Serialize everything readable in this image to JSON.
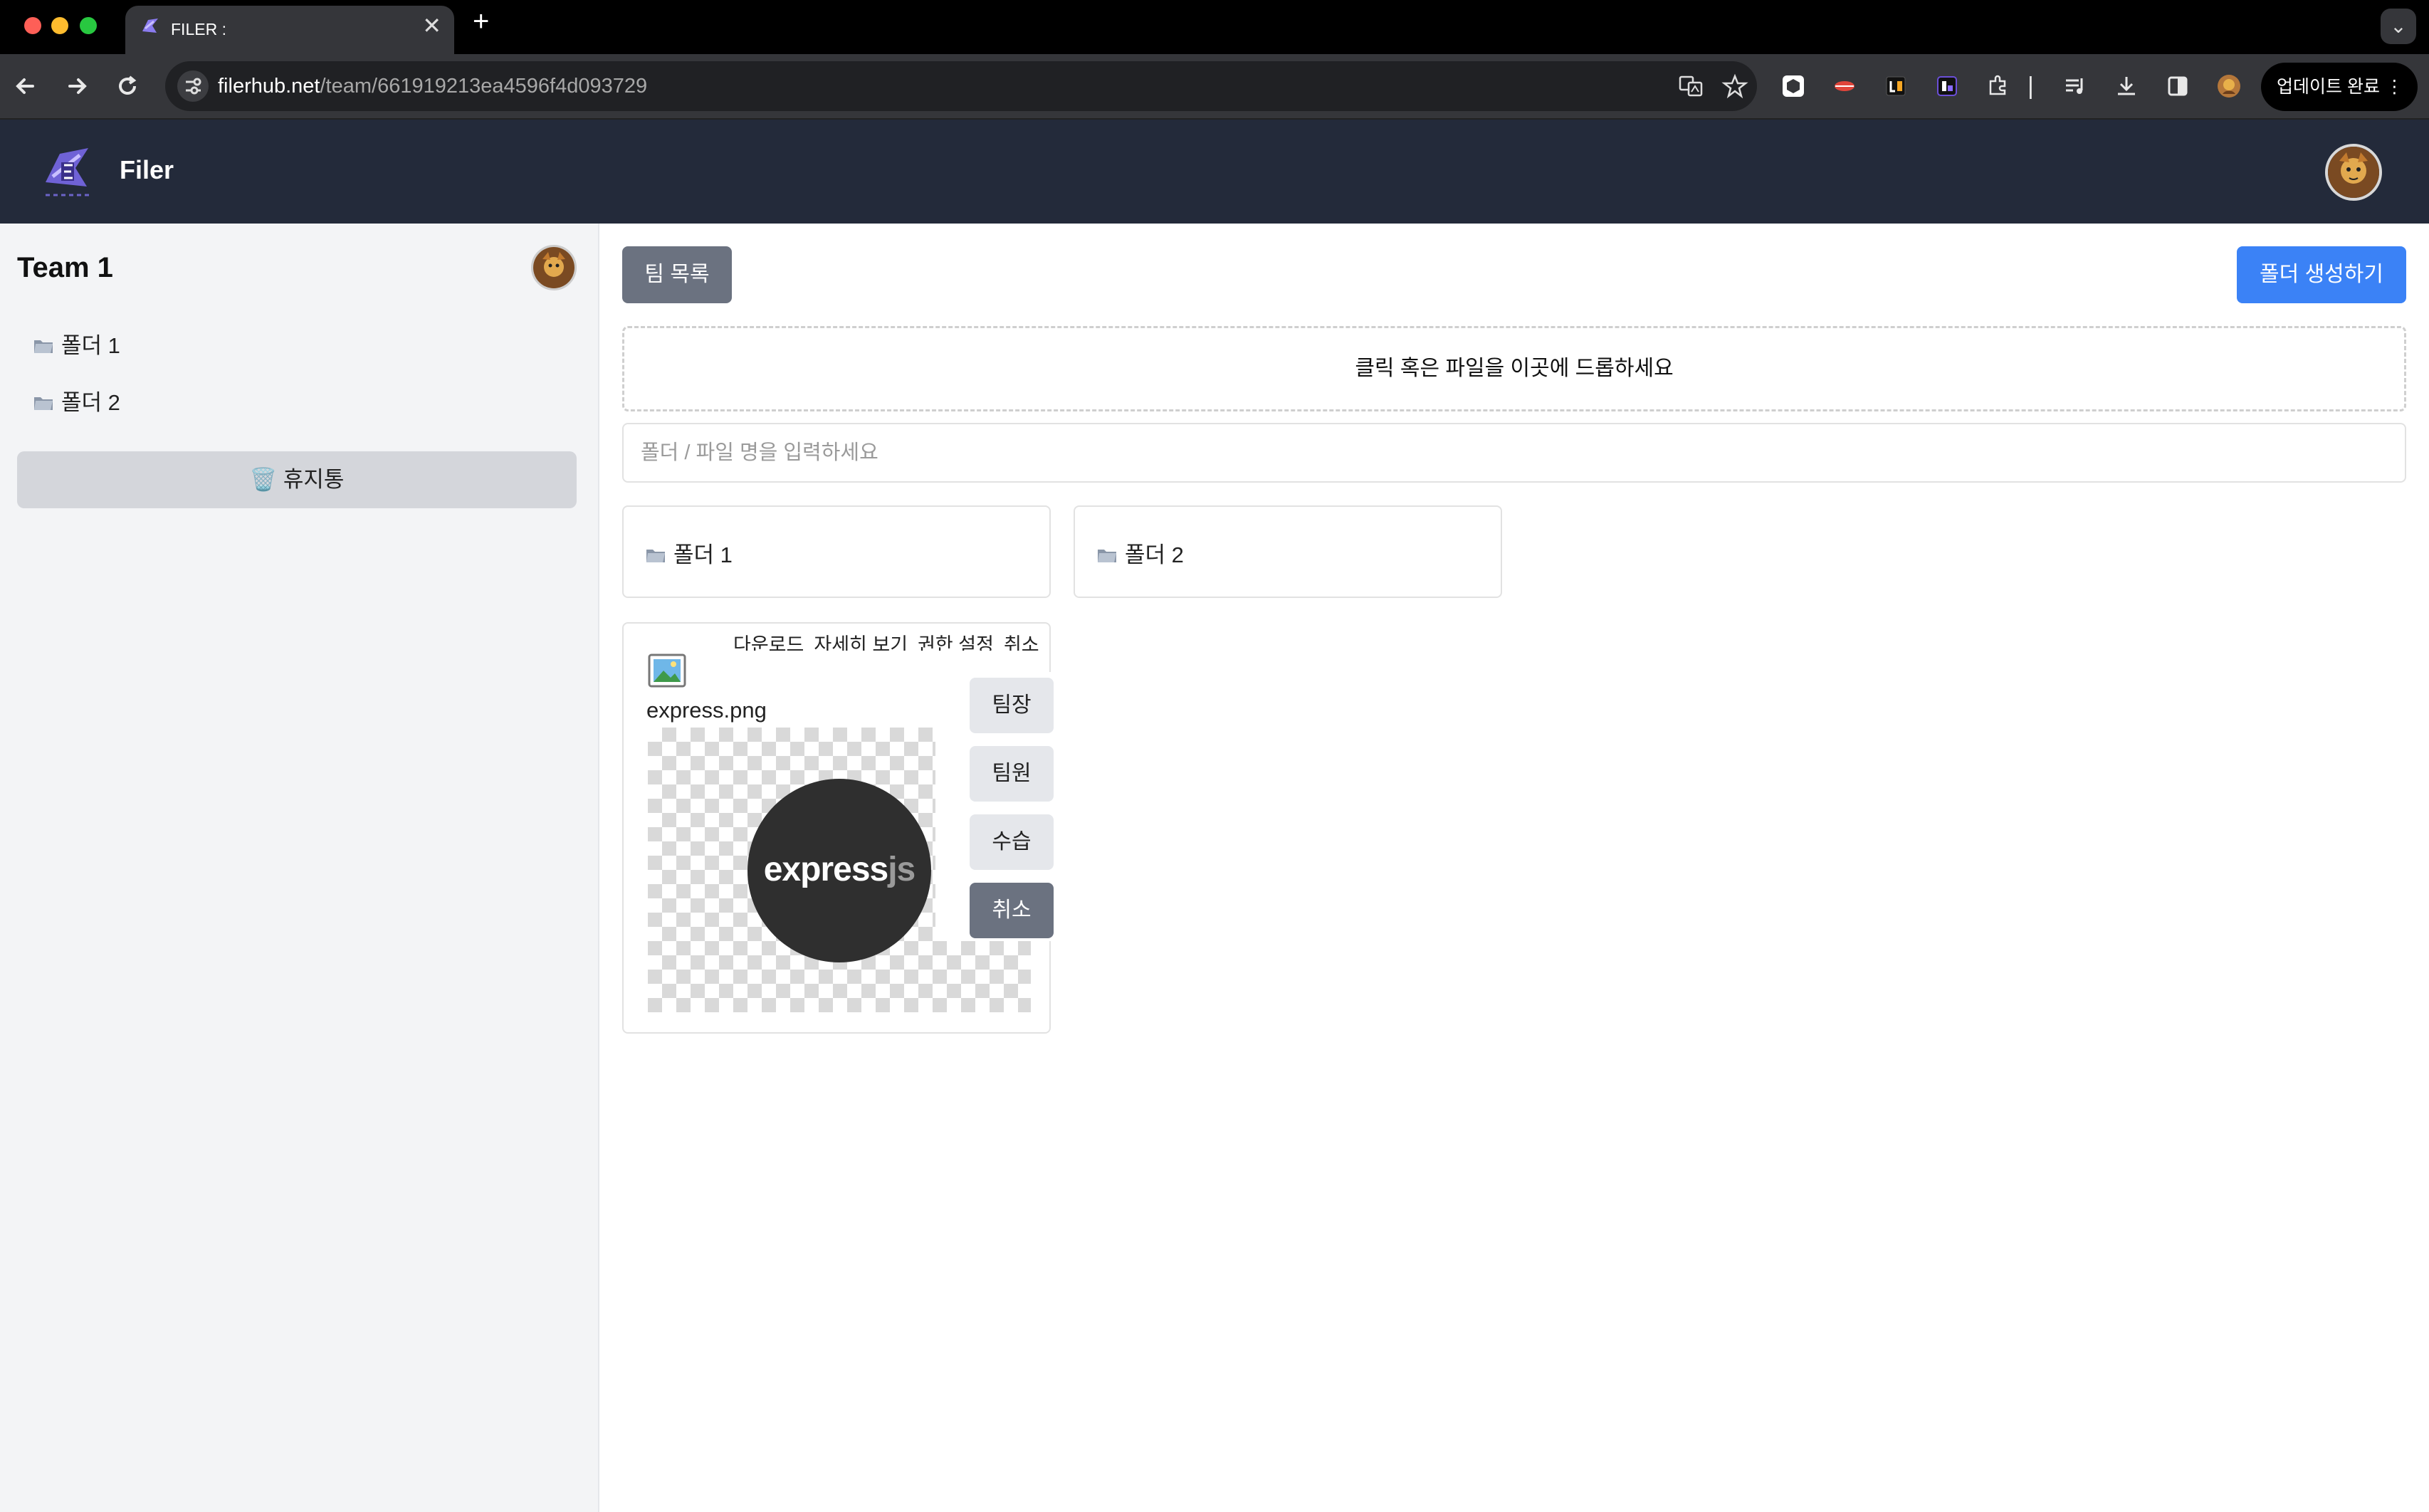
{
  "browser": {
    "tab_title": "FILER :",
    "tab_close": "✕",
    "new_tab": "+",
    "tab_menu": "⌄",
    "url_host": "filerhub.net",
    "url_path": "/team/661919213ea4596f4d093729",
    "update_label": "업데이트 완료",
    "update_menu": "⋮"
  },
  "app": {
    "name": "Filer"
  },
  "sidebar": {
    "team_name": "Team 1",
    "folders": [
      {
        "label": "폴더 1"
      },
      {
        "label": "폴더 2"
      }
    ],
    "trash_label": "🗑️ 휴지통"
  },
  "main": {
    "team_list_button": "팀 목록",
    "create_folder_button": "폴더 생성하기",
    "dropzone_text": "클릭 혹은 파일을 이곳에 드롭하세요",
    "search_placeholder": "폴더 / 파일 명을 입력하세요",
    "folders": [
      {
        "label": "폴더 1"
      },
      {
        "label": "폴더 2"
      }
    ],
    "file": {
      "name": "express.png",
      "menu": [
        "다운로드",
        "자세히 보기",
        "권한 설정",
        "취소"
      ],
      "preview_text_a": "express",
      "preview_text_b": "js"
    },
    "role_menu": [
      "팀장",
      "팀원",
      "수습",
      "취소"
    ]
  },
  "icons": {
    "back": "back-arrow-icon",
    "forward": "forward-arrow-icon",
    "reload": "reload-icon",
    "translate": "translate-icon",
    "star": "bookmark-star-icon",
    "folder": "folder-icon",
    "trash": "trash-icon",
    "image_file": "image-file-icon"
  },
  "colors": {
    "header_bg": "#232a3a",
    "primary_button": "#3b82f6",
    "secondary_button": "#6b7280",
    "sidebar_bg": "#f3f4f6"
  }
}
